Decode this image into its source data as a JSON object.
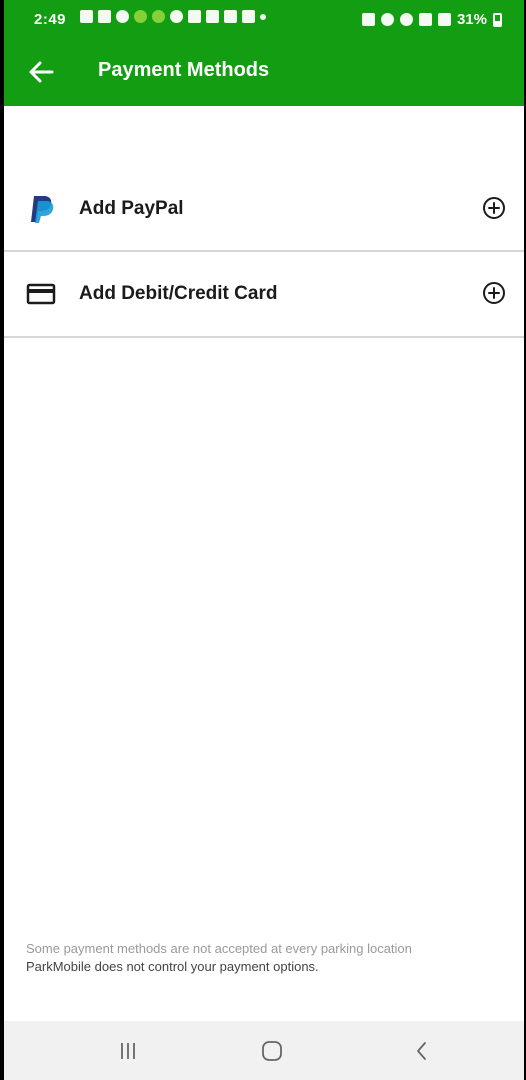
{
  "status_bar": {
    "time": "2:49",
    "battery": "31%"
  },
  "app_bar": {
    "title": "Payment Methods",
    "back_icon": "back-arrow-icon"
  },
  "payment_options": [
    {
      "label": "Add PayPal",
      "icon": "paypal-icon",
      "action_icon": "add-circle-icon"
    },
    {
      "label": "Add Debit/Credit Card",
      "icon": "credit-card-icon",
      "action_icon": "add-circle-icon"
    }
  ],
  "footer": {
    "note_line1": "Some payment methods are not accepted at every parking location",
    "note_line2": "ParkMobile does not control your payment options."
  },
  "nav_bar": {
    "recents_icon": "recents-icon",
    "home_icon": "home-icon",
    "back_icon": "nav-back-icon"
  },
  "colors": {
    "primary": "#129d12",
    "paypal_dark": "#253b80",
    "paypal_light": "#179bd7",
    "divider": "#d6d6d6"
  }
}
